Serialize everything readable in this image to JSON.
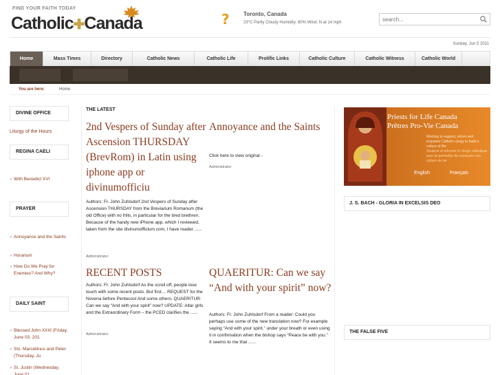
{
  "header": {
    "logo_tagline": "FIND YOUR FAITH TODAY",
    "logo_word1": "Catholic",
    "logo_cross": "✚",
    "logo_word2": "Canada",
    "weather_icon": "?",
    "weather_city": "Toronto, Canada",
    "weather_details": "23°C  Partly Cloudy  Humidity: 60%  Wind: N at 14 mph",
    "search_placeholder": "search..."
  },
  "date": "Sunday, Jun 5 2011",
  "nav": {
    "items": [
      "Home",
      "Mass Times",
      "Directory",
      "Catholic News",
      "Catholic Life",
      "Prolific Links",
      "Catholic Culture",
      "Catholic Witness",
      "Catholic World"
    ]
  },
  "breadcrumb": {
    "label": "You are here:",
    "home": "Home"
  },
  "sidebar": {
    "divine_office": "DIVINE OFFICE",
    "liturgy": "Liturgy of the Hours",
    "regina_caeli": "REGINA CAELI",
    "regina_items": [
      "With Benedict XVI"
    ],
    "prayer": "PRAYER",
    "prayer_items": [
      "Annoyance and the Saints",
      "Horarium",
      "How Do We Pray for Enemies? And Why?"
    ],
    "daily_saint": "DAILY SAINT",
    "saint_items": [
      "Blessed John XXIII (Friday, June 03, 201",
      "Sts. Marcellinus and Peter (Thursday, Ju",
      "St. Justin (Wednesday, June 01"
    ]
  },
  "main": {
    "latest_heading": "THE LATEST",
    "posts": [
      {
        "title": "2nd Vespers of Sunday after Ascension THURSDAY (BrevRom) in Latin using iphone app or divinumofficiu",
        "body": "Authors: Fr. John Zuhlsdorf 2nd Vespers of Sunday after Ascension THURSDAY from the Breviarium Romanum (the old Office) with no frills, in particular for the tired brethren. Because of the handy new iPhone app, which I reviewed, taken from the site divinumofficium.com, I have reader ......",
        "author": "Administrator"
      },
      {
        "title": "Annoyance and the Saints",
        "body": "Click here to view original -",
        "author": "Administrator"
      },
      {
        "title": "RECENT POSTS",
        "body": "Authors: Fr. John Zuhlsdorf As the scroll off, people lose touch with some recent posts. But first… REQUEST for the Novena before Pentecost And some others. QUAERITUR: Can we say “And with your spirit” now? UPDATE: Altar girls and the Extraordinary Form – the PCED clarifies the ......",
        "author": "Administrator"
      },
      {
        "title": "QUAERITUR: Can we say “And with your spirit” now?",
        "body": "Authors: Fr. John Zuhlsdorf From a reader: Could you perhaps use some of the new translation now? For example saying “And with your spirit.” under your breath or even using it in confirmation when the bishop says “Peace be with you.” It seems to me that ......",
        "author": "Administrator"
      }
    ]
  },
  "right": {
    "ad_title_en": "Priests for Life Canada",
    "ad_title_fr": "Prêtres Pro-Vie Canada",
    "ad_line_en": "Working to support, inform and empower Catholic clergy to build a culture of life.",
    "ad_line_fr": "Soutenir et informer le clergé catholique pour lui permettre de construire une culture de vie",
    "ad_lang_en": "English",
    "ad_lang_fr": "Français",
    "box1": "J. S. BACH - GLORIA IN EXCELSIS DEO",
    "box2": "THE FALSE FIVE"
  },
  "colors": {
    "accent": "#8a3a1e",
    "nav_active": "#6a5f55",
    "subnav": "#3a3128",
    "ad_orange": "#d6771f"
  }
}
